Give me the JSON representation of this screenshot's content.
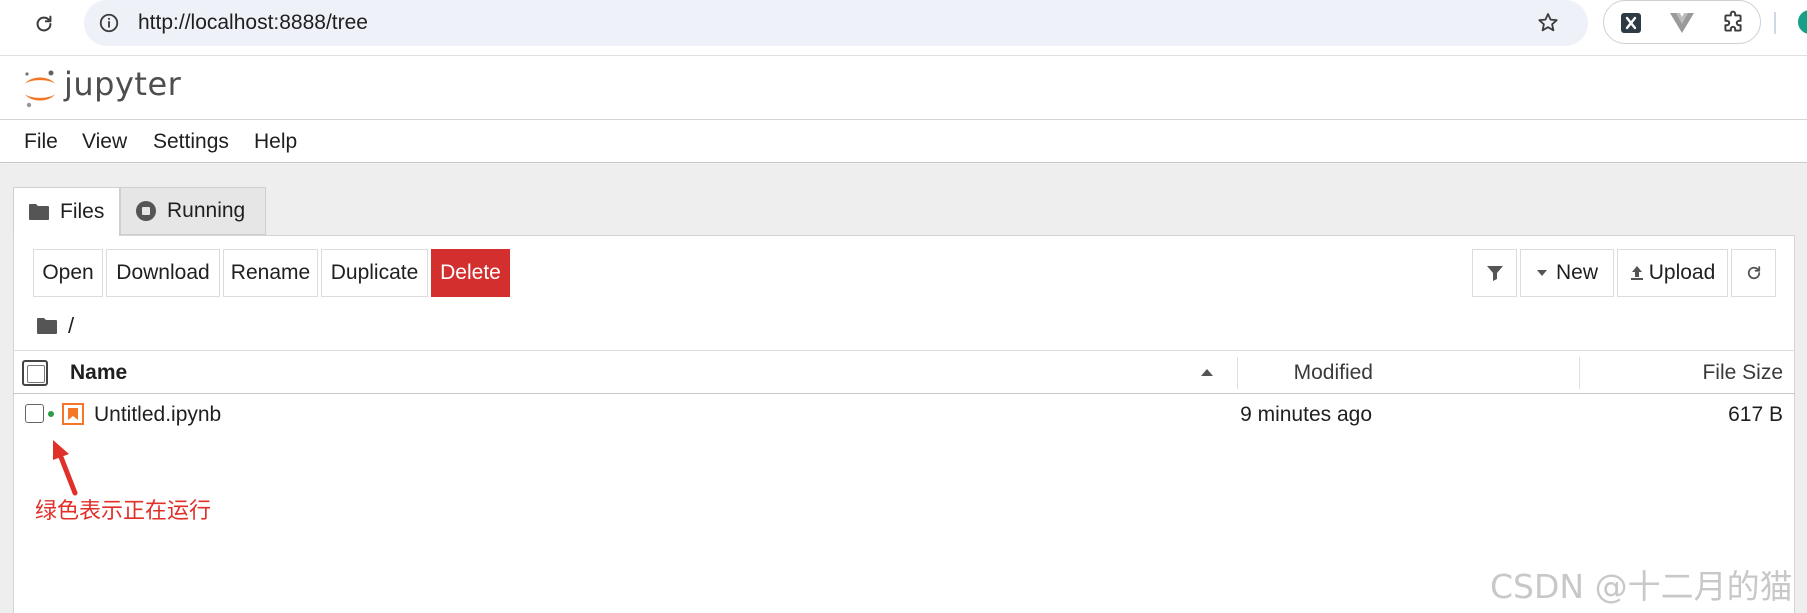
{
  "browser": {
    "url": "http://localhost:8888/tree"
  },
  "app": {
    "wordmark": "jupyter"
  },
  "menu": {
    "items": [
      "File",
      "View",
      "Settings",
      "Help"
    ]
  },
  "tabs": {
    "files": "Files",
    "running": "Running"
  },
  "toolbar": {
    "open": "Open",
    "download": "Download",
    "rename": "Rename",
    "duplicate": "Duplicate",
    "delete": "Delete",
    "new": "New",
    "upload": "Upload"
  },
  "breadcrumb": {
    "path": "/"
  },
  "columns": {
    "name": "Name",
    "modified": "Modified",
    "file_size": "File Size"
  },
  "files": [
    {
      "name": "Untitled.ipynb",
      "modified": "9 minutes ago",
      "size": "617 B",
      "running": true
    }
  ],
  "annotation": {
    "text": "绿色表示正在运行"
  },
  "watermark": "CSDN @十二月的猫",
  "colors": {
    "delete_button": "#d32f2f",
    "running_dot": "#2e9b47",
    "jupyter_orange": "#f37726",
    "annotation_red": "#e0302a"
  }
}
